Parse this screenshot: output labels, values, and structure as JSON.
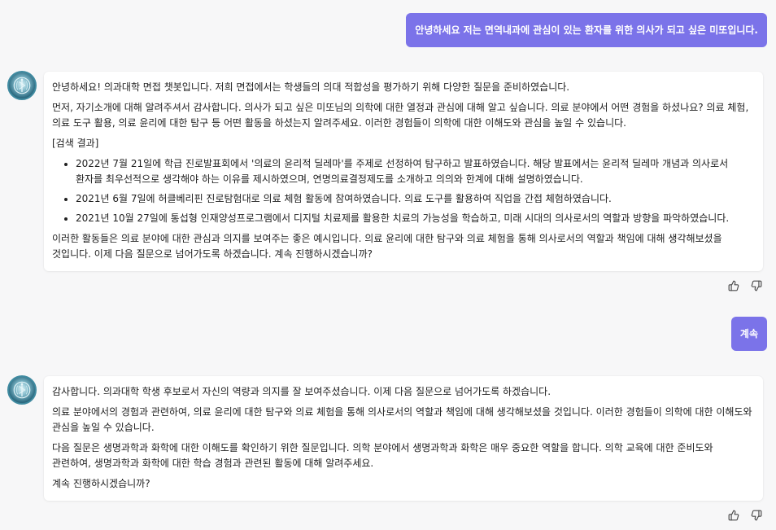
{
  "conversation": {
    "user_messages": [
      "안녕하세요 저는 면역내과에 관심이 있는 환자를 위한 의사가 되고 싶은 미또입니다.",
      "계속"
    ],
    "bot_message_1": {
      "intro": "안녕하세요! 의과대학 면접 챗봇입니다. 저희 면접에서는 학생들의 의대 적합성을 평가하기 위해 다양한 질문을 준비하였습니다.",
      "question": "먼저, 자기소개에 대해 알려주셔서 감사합니다. 의사가 되고 싶은 미또님의 의학에 대한 열정과 관심에 대해 알고 싶습니다. 의료 분야에서 어떤 경험을 하셨나요? 의료 체험, 의료 도구 활용, 의료 윤리에 대한 탐구 등 어떤 활동을 하셨는지 알려주세요. 이러한 경험들이 의학에 대한 이해도와 관심을 높일 수 있습니다.",
      "search_label": "[검색 결과]",
      "results": [
        "2022년 7월 21일에 학급 진로발표회에서 '의료의 윤리적 딜레마'를 주제로 선정하여 탐구하고 발표하였습니다. 해당 발표에서는 윤리적 딜레마 개념과 의사로서 환자를 최우선적으로 생각해야 하는 이유를 제시하였으며, 연명의료결정제도를 소개하고 의의와 한계에 대해 설명하였습니다.",
        "2021년 6월 7일에 허클베리핀 진로탐험대로 의료 체험 활동에 참여하였습니다. 의료 도구를 활용하여 직업을 간접 체험하였습니다.",
        "2021년 10월 27일에 통섭형 인재양성프로그램에서 디지털 치료제를 활용한 치료의 가능성을 학습하고, 미래 시대의 의사로서의 역할과 방향을 파악하였습니다."
      ],
      "conclusion": "이러한 활동들은 의료 분야에 대한 관심과 의지를 보여주는 좋은 예시입니다. 의료 윤리에 대한 탐구와 의료 체험을 통해 의사로서의 역할과 책임에 대해 생각해보셨을 것입니다. 이제 다음 질문으로 넘어가도록 하겠습니다. 계속 진행하시겠습니까?"
    },
    "bot_message_2": {
      "paragraphs": [
        "감사합니다. 의과대학 학생 후보로서 자신의 역량과 의지를 잘 보여주셨습니다. 이제 다음 질문으로 넘어가도록 하겠습니다.",
        "의료 분야에서의 경험과 관련하여, 의료 윤리에 대한 탐구와 의료 체험을 통해 의사로서의 역할과 책임에 대해 생각해보셨을 것입니다. 이러한 경험들이 의학에 대한 이해도와 관심을 높일 수 있습니다.",
        "다음 질문은 생명과학과 화학에 대한 이해도를 확인하기 위한 질문입니다. 의학 분야에서 생명과학과 화학은 매우 중요한 역할을 합니다. 의학 교육에 대한 준비도와 관련하여, 생명과학과 화학에 대한 학습 경험과 관련된 활동에 대해 알려주세요.",
        "계속 진행하시겠습니까?"
      ]
    }
  },
  "icons": {
    "avatar": "medical-emblem-icon",
    "like": "thumbs-up-icon",
    "dislike": "thumbs-down-icon"
  },
  "colors": {
    "user_bubble": "#7b73e9",
    "background": "#f7f7f8",
    "card": "#ffffff"
  }
}
